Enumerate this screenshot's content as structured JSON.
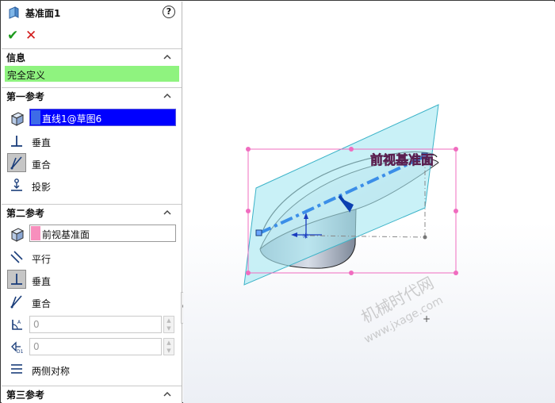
{
  "panel": {
    "title": "基准面1",
    "help_label": "?",
    "ok_label": "✔",
    "cancel_label": "✕",
    "sections": {
      "info": {
        "label": "信息",
        "status": "完全定义",
        "status_color": "#8ff37f"
      },
      "first_ref": {
        "label": "第一参考",
        "selection": "直线1@草图6",
        "options": [
          "垂直",
          "重合",
          "投影"
        ],
        "active_option": "重合"
      },
      "second_ref": {
        "label": "第二参考",
        "selection": "前视基准面",
        "options": [
          "平行",
          "垂直",
          "重合"
        ],
        "active_option": "垂直",
        "angle_value": "0",
        "distance_value": "0",
        "symmetric_label": "两侧对称"
      },
      "third_ref": {
        "label": "第三参考"
      }
    }
  },
  "viewport": {
    "plane_label": "前视基准面",
    "watermark_cn": "机械时代网",
    "watermark_url": "www.jxage.com",
    "plane_color": "#a8e8f2",
    "selection_color": "#f06cbf"
  }
}
